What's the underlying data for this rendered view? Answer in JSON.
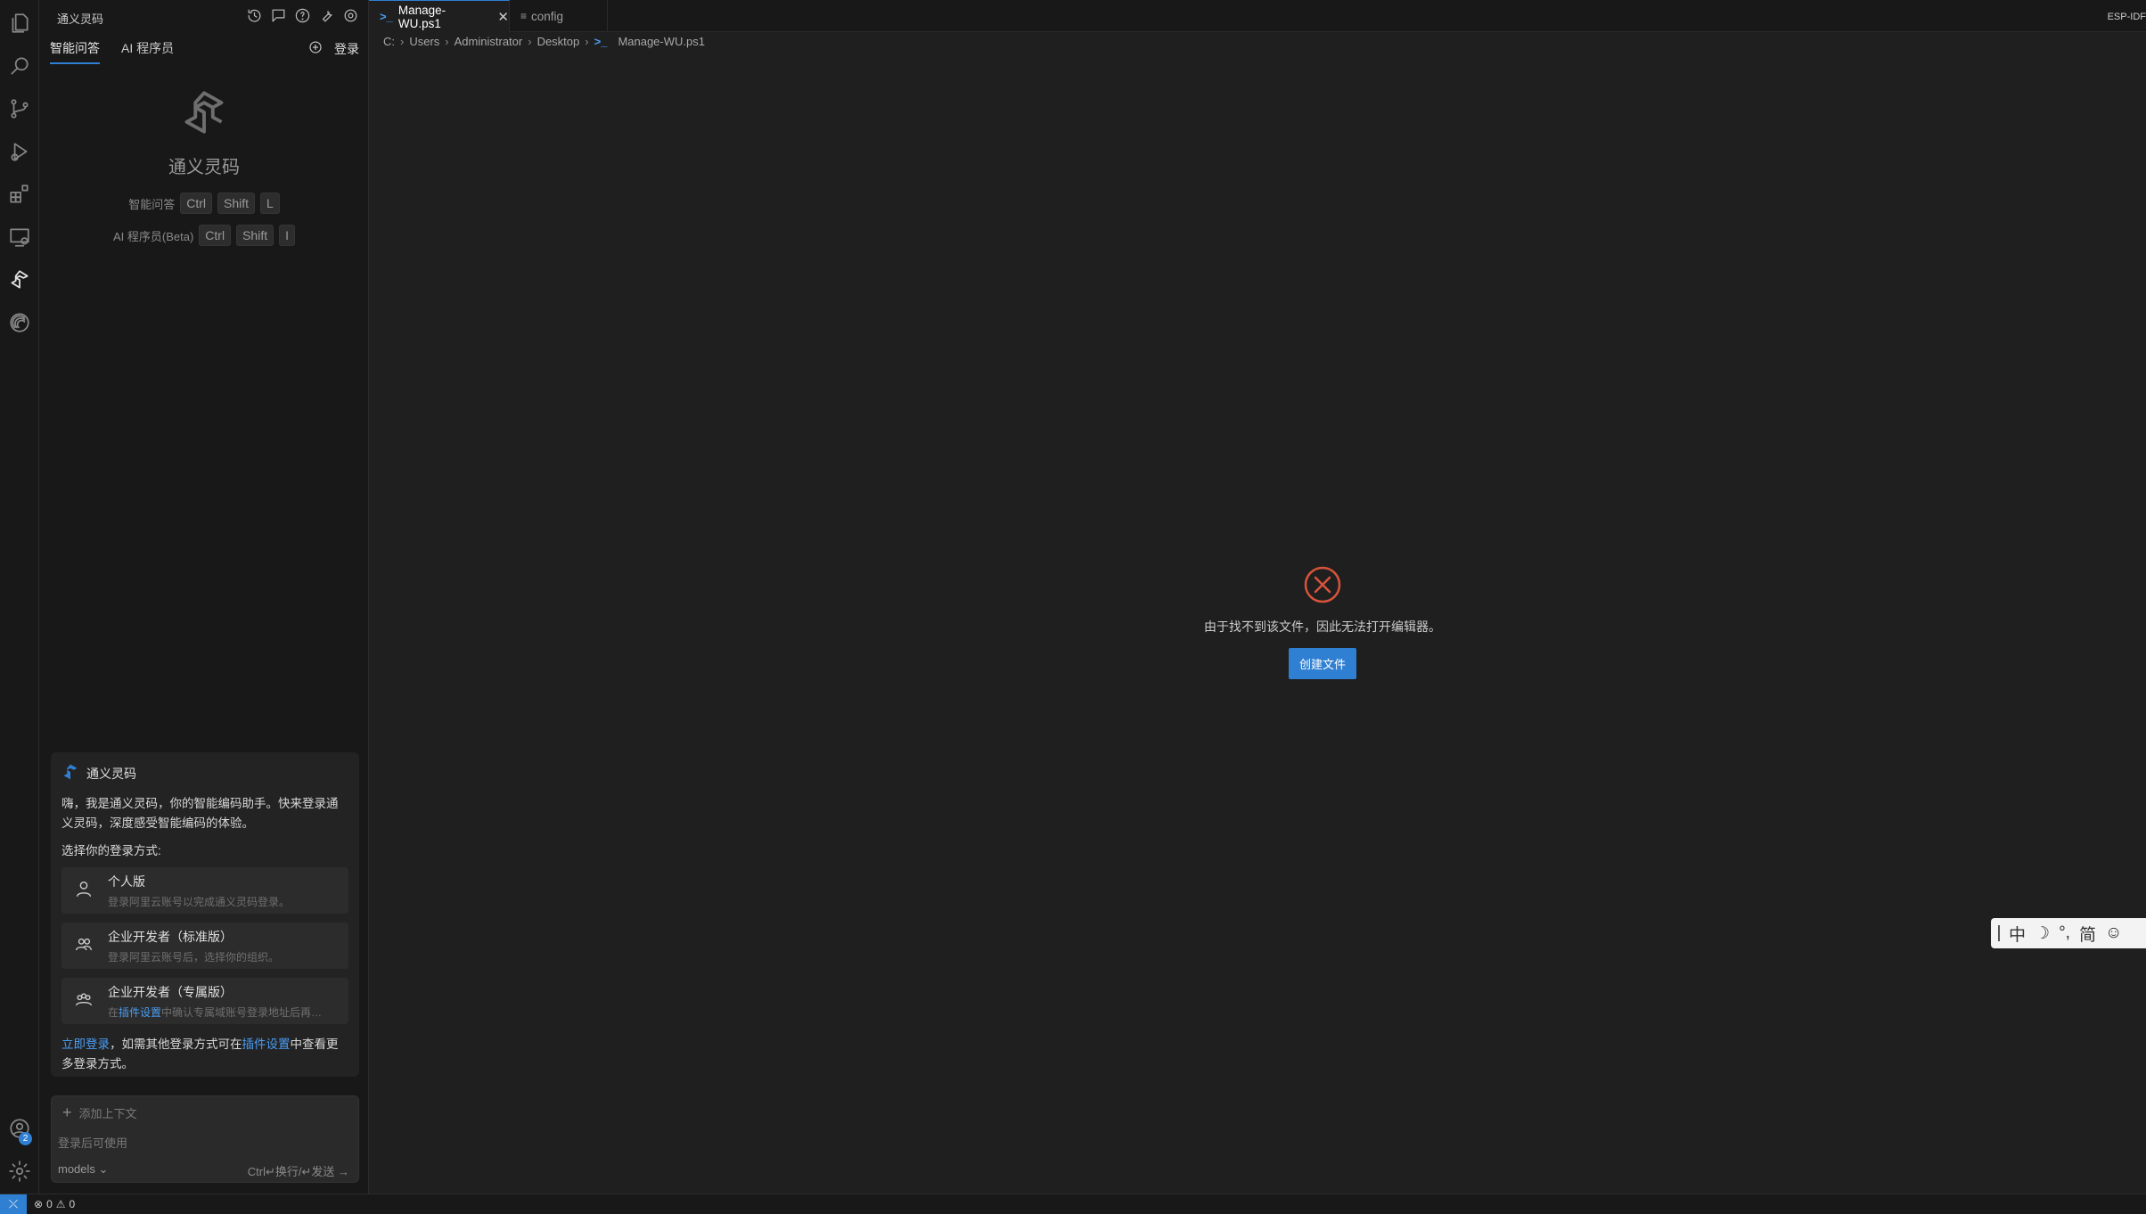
{
  "activity_bar": {
    "items": [
      "explorer-icon",
      "search-icon",
      "source-control-icon",
      "run-debug-icon",
      "extensions-icon",
      "remote-explorer-icon",
      "tongyi-lingma-icon",
      "esp-idf-icon"
    ],
    "accounts_badge": "2"
  },
  "side_panel": {
    "title": "通义灵码",
    "tabs": [
      "智能问答",
      "AI 程序员"
    ],
    "login_label": "登录",
    "welcome": {
      "title": "通义灵码",
      "shortcuts": [
        {
          "label": "智能问答",
          "keys": [
            "Ctrl",
            "Shift",
            "L"
          ]
        },
        {
          "label": "AI 程序员(Beta)",
          "keys": [
            "Ctrl",
            "Shift",
            "I"
          ]
        }
      ]
    },
    "login_card": {
      "name": "通义灵码",
      "intro": "嗨，我是通义灵码，你的智能编码助手。快来登录通义灵码，深度感受智能编码的体验。",
      "choose_label": "选择你的登录方式:",
      "options": [
        {
          "title": "个人版",
          "desc": "登录阿里云账号以完成通义灵码登录。"
        },
        {
          "title": "企业开发者（标准版）",
          "desc": "登录阿里云账号后，选择你的组织。"
        },
        {
          "title": "企业开发者（专属版）",
          "desc_prefix": "在",
          "desc_link": "插件设置",
          "desc_suffix": "中确认专属域账号登录地址后再登..."
        }
      ],
      "foot_link1": "立即登录",
      "foot_mid": "，如需其他登录方式可在",
      "foot_link2": "插件设置",
      "foot_end": "中查看更多登录方式。"
    },
    "input": {
      "add_context": "添加上下文",
      "placeholder": "登录后可使用",
      "models": "models",
      "send_hint": "Ctrl↵换行/↵发送"
    }
  },
  "editor": {
    "tabs": [
      {
        "label": "Manage-WU.ps1",
        "active": true
      },
      {
        "label": "config",
        "active": false
      }
    ],
    "top_right_label": "ESP-IDF",
    "breadcrumb": [
      "C:",
      "Users",
      "Administrator",
      "Desktop",
      "Manage-WU.ps1"
    ],
    "error_message": "由于找不到该文件，因此无法打开编辑器。",
    "create_button": "创建文件"
  },
  "ime": [
    "中",
    "☽",
    "°,",
    "简",
    "☺"
  ],
  "status_bar": {
    "errors": "0",
    "warnings": "0"
  },
  "colors": {
    "accent": "#2f7fd2",
    "error": "#d9533b",
    "link": "#4a9df5"
  }
}
